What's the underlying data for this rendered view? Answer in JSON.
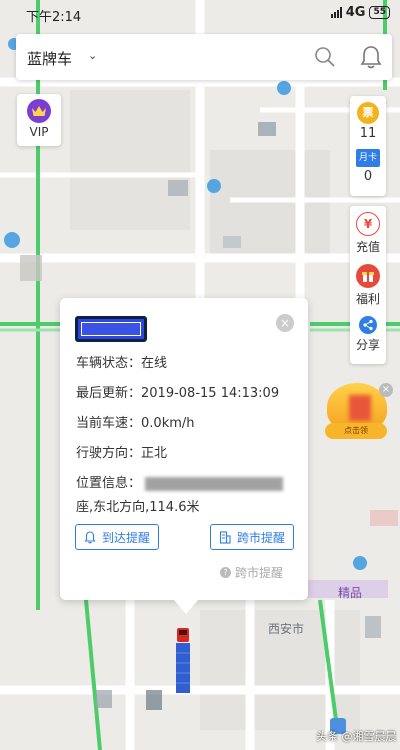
{
  "status_bar": {
    "time": "下午2:14",
    "network": "4G",
    "battery": "55"
  },
  "search_bar": {
    "plate_color": "蓝牌车"
  },
  "vip": {
    "label": "VIP"
  },
  "counts_panel": {
    "ticket_icon": "票",
    "ticket_count": "11",
    "month_card_icon": "月卡",
    "month_card_count": "0"
  },
  "actions": [
    {
      "label": "充值",
      "icon": "recharge-icon"
    },
    {
      "label": "福利",
      "icon": "gift-icon"
    },
    {
      "label": "分享",
      "icon": "share-icon"
    }
  ],
  "ad": {
    "tag": "点击领"
  },
  "popup": {
    "status_label": "车辆状态：",
    "status_value": "在线",
    "update_label": "最后更新：",
    "update_value": "2019-08-15 14:13:09",
    "speed_label": "当前车速：",
    "speed_value": "0.0km/h",
    "direction_label": "行驶方向：",
    "direction_value": "正北",
    "location_label": "位置信息：",
    "location_suffix": "座,东北方向,114.6米",
    "arrive_button": "到达提醒",
    "cross_city_button": "跨市提醒",
    "hint": "跨市提醒"
  },
  "map_labels": {
    "label_1": "精品",
    "label_2": "西安市"
  },
  "watermark": "头条 @湘雪晨晨",
  "colors": {
    "accent": "#2f7ee6",
    "road_green": "#4ccd6a",
    "vip": "#7b3fd0",
    "coin": "#f6b21b"
  }
}
